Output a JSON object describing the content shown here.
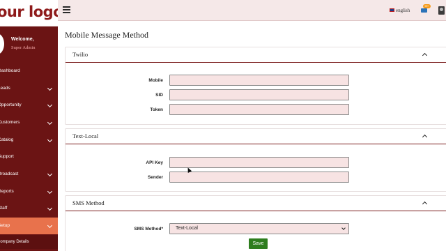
{
  "logo": {
    "text": "our logo",
    "mark": "®"
  },
  "welcome": {
    "title": "Welcome,",
    "role": "Super Admin"
  },
  "sidebar": {
    "items": [
      {
        "label": "Dashboard",
        "has_submenu": false
      },
      {
        "label": "Leads",
        "has_submenu": true
      },
      {
        "label": "Opportunity",
        "has_submenu": true
      },
      {
        "label": "Customers",
        "has_submenu": true
      },
      {
        "label": "Catalog",
        "has_submenu": true
      },
      {
        "label": "Support",
        "has_submenu": false
      },
      {
        "label": "Broadcast",
        "has_submenu": true
      },
      {
        "label": "Reports",
        "has_submenu": true
      },
      {
        "label": "Staff",
        "has_submenu": true
      },
      {
        "label": "Setup",
        "has_submenu": true,
        "active": true
      }
    ],
    "subitems": [
      {
        "label": "Company Details"
      }
    ]
  },
  "topbar": {
    "language": "english",
    "mail_badge": "99+"
  },
  "page": {
    "title": "Mobile Message Method"
  },
  "sections": {
    "twilio": {
      "title": "Twilio",
      "fields": [
        {
          "label": "Mobile",
          "value": ""
        },
        {
          "label": "SID",
          "value": ""
        },
        {
          "label": "Token",
          "value": ""
        }
      ]
    },
    "textlocal": {
      "title": "Text-Local",
      "fields": [
        {
          "label": "API Key",
          "value": ""
        },
        {
          "label": "Sender",
          "value": ""
        }
      ]
    },
    "sms": {
      "title": "SMS Method",
      "method_label": "SMS Method*",
      "selected": "Text-Local"
    }
  },
  "actions": {
    "save_label": "Save"
  },
  "colors": {
    "sidebar_bg": "#6b1414",
    "active_item": "#e8724c",
    "topbar_bg": "#f5e8e8",
    "input_bg": "#f7e3e3",
    "save_bg": "#2e7d1e",
    "accent_line": "#7a1d1d"
  }
}
